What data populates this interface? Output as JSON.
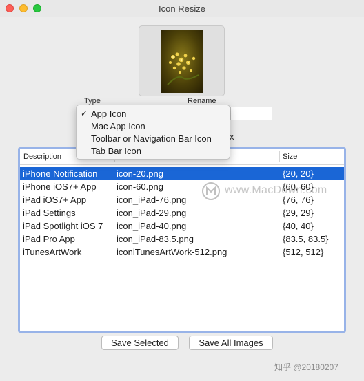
{
  "window": {
    "title": "Icon Resize"
  },
  "controls": {
    "type_label": "Type",
    "rename_label": "Rename",
    "rename_value": "",
    "x_suffix": "x"
  },
  "type_menu": {
    "items": [
      {
        "label": "App Icon",
        "checked": true,
        "check_glyph": "✓"
      },
      {
        "label": "Mac App Icon",
        "checked": false
      },
      {
        "label": "Toolbar or Navigation Bar Icon",
        "checked": false
      },
      {
        "label": "Tab Bar Icon",
        "checked": false
      }
    ]
  },
  "table": {
    "columns": [
      "Description",
      "",
      "Size"
    ],
    "rows": [
      {
        "description": "iPhone Notification",
        "file": "icon-20.png",
        "size": "{20, 20}",
        "selected": true
      },
      {
        "description": "iPhone iOS7+ App",
        "file": "icon-60.png",
        "size": "{60, 60}"
      },
      {
        "description": "iPad iOS7+ App",
        "file": "icon_iPad-76.png",
        "size": "{76, 76}"
      },
      {
        "description": "iPad Settings",
        "file": "icon_iPad-29.png",
        "size": "{29, 29}"
      },
      {
        "description": "iPad Spotlight iOS 7",
        "file": "icon_iPad-40.png",
        "size": "{40, 40}"
      },
      {
        "description": "iPad Pro App",
        "file": "icon_iPad-83.5.png",
        "size": "{83.5, 83.5}"
      },
      {
        "description": "iTunesArtWork",
        "file": "iconiTunesArtWork-512.png",
        "size": "{512, 512}"
      }
    ],
    "selection_color": "#1a66d6"
  },
  "buttons": {
    "save_selected": "Save Selected",
    "save_all": "Save All Images"
  },
  "watermarks": {
    "center": "www.MacDown.com",
    "footer": "知乎 @20180207"
  }
}
